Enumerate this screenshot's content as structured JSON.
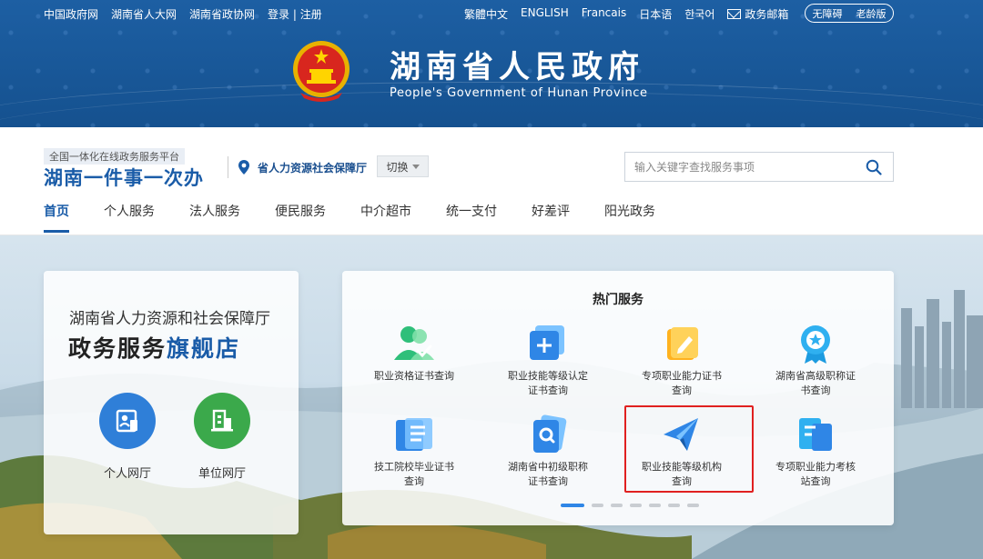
{
  "top_links_left": [
    "中国政府网",
    "湖南省人大网",
    "湖南省政协网",
    "登录 | 注册"
  ],
  "top_links_right": [
    "繁體中文",
    "ENGLISH",
    "Francais",
    "日本语",
    "한국어"
  ],
  "mail_label": "政务邮箱",
  "accessibility": {
    "barrier_free": "无障碍",
    "elderly": "老龄版"
  },
  "header": {
    "title": "湖南省人民政府",
    "subtitle": "People's Government of Hunan Province"
  },
  "service_bar": {
    "tag": "全国一体化在线政务服务平台",
    "brand": "湖南一件事一次办",
    "location": "省人力资源社会保障厅",
    "switch_label": "切换"
  },
  "search": {
    "placeholder": "输入关键字查找服务事项",
    "value": ""
  },
  "nav": {
    "items": [
      {
        "label": "首页",
        "active": true
      },
      {
        "label": "个人服务"
      },
      {
        "label": "法人服务"
      },
      {
        "label": "便民服务"
      },
      {
        "label": "中介超市"
      },
      {
        "label": "统一支付"
      },
      {
        "label": "好差评"
      },
      {
        "label": "阳光政务"
      }
    ]
  },
  "left_card": {
    "department": "湖南省人力资源和社会保障厅",
    "store_prefix": "政务服务",
    "store_highlight": "旗舰店",
    "personal_hall": "个人网厅",
    "unit_hall": "单位网厅"
  },
  "hot_services": {
    "title": "热门服务",
    "items": [
      {
        "line1": "职业资格证书查询",
        "line2": "",
        "icon": "people-check-icon"
      },
      {
        "line1": "职业技能等级认定",
        "line2": "证书查询",
        "icon": "certificate-plus-icon"
      },
      {
        "line1": "专项职业能力证书",
        "line2": "查询",
        "icon": "book-edit-icon"
      },
      {
        "line1": "湖南省高级职称证",
        "line2": "书查询",
        "icon": "award-star-icon"
      },
      {
        "line1": "技工院校毕业证书",
        "line2": "查询",
        "icon": "diploma-icon"
      },
      {
        "line1": "湖南省中初级职称",
        "line2": "证书查询",
        "icon": "search-document-icon"
      },
      {
        "line1": "职业技能等级机构",
        "line2": "查询",
        "icon": "send-plane-icon",
        "highlighted": true
      },
      {
        "line1": "专项职业能力考核",
        "line2": "站查询",
        "icon": "form-list-icon"
      }
    ],
    "pagination": {
      "total": 7,
      "active": 0
    }
  },
  "colors": {
    "brand_blue": "#1a5ca8",
    "header_bg": "#1d5fa3",
    "highlight_red": "#e02020",
    "unit_green": "#3ba94b"
  }
}
